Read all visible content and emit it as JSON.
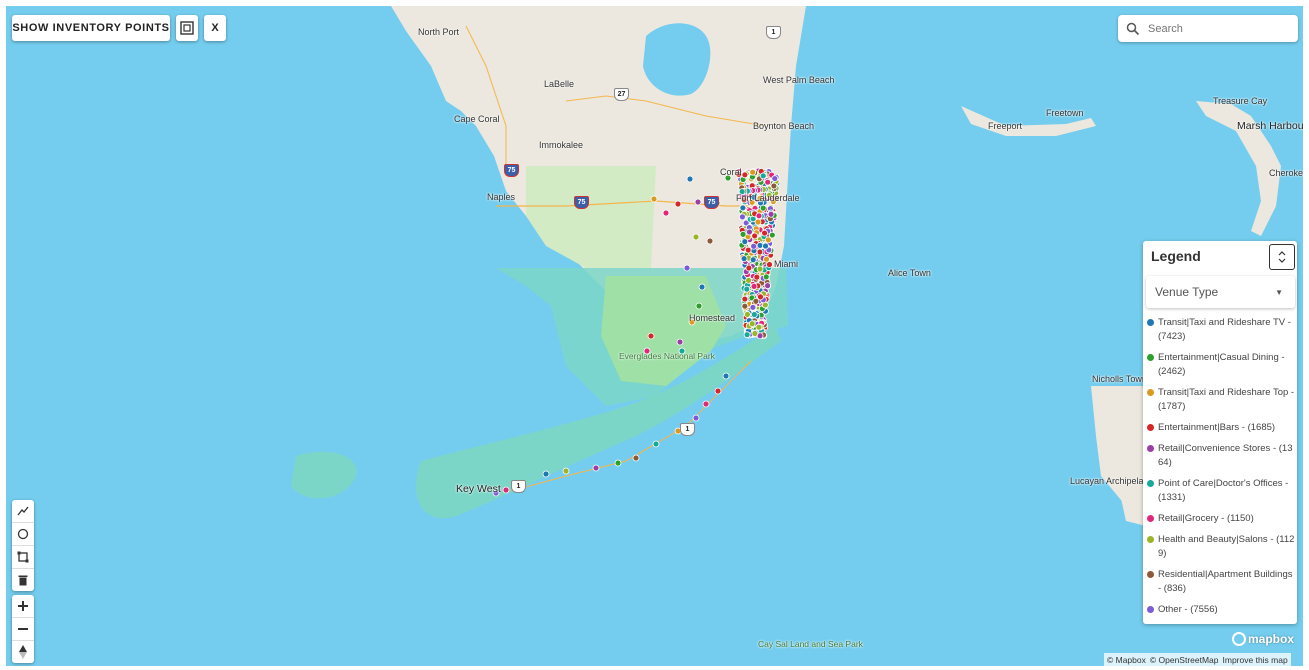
{
  "toolbar": {
    "show_inventory_label": "SHOW INVENTORY POINTS",
    "close_label": "X"
  },
  "search": {
    "placeholder": "Search"
  },
  "legend": {
    "title": "Legend",
    "dropdown_value": "Venue Type",
    "items": [
      {
        "label": "Transit|Taxi and Rideshare TV - (7423)",
        "color": "#1f77b4"
      },
      {
        "label": "Entertainment|Casual Dining - (2462)",
        "color": "#2ca02c"
      },
      {
        "label": "Transit|Taxi and Rideshare Top - (1787)",
        "color": "#d99a1e"
      },
      {
        "label": "Entertainment|Bars - (1685)",
        "color": "#d62728"
      },
      {
        "label": "Retail|Convenience Stores - (1364)",
        "color": "#9b3fa6"
      },
      {
        "label": "Point of Care|Doctor's Offices - (1331)",
        "color": "#17a89a"
      },
      {
        "label": "Retail|Grocery - (1150)",
        "color": "#e0287a"
      },
      {
        "label": "Health and Beauty|Salons - (1129)",
        "color": "#9ab52a"
      },
      {
        "label": "Residential|Apartment Buildings - (836)",
        "color": "#8c5a3a"
      },
      {
        "label": "Other - (7556)",
        "color": "#7b5cd6"
      }
    ]
  },
  "map": {
    "places": [
      {
        "name": "North Port",
        "cls": "place"
      },
      {
        "name": "LaBelle",
        "cls": "place"
      },
      {
        "name": "Cape Coral",
        "cls": "place"
      },
      {
        "name": "Immokalee",
        "cls": "place"
      },
      {
        "name": "Naples",
        "cls": "place"
      },
      {
        "name": "West Palm Beach",
        "cls": "place"
      },
      {
        "name": "Boynton Beach",
        "cls": "place"
      },
      {
        "name": "Coral",
        "cls": "place"
      },
      {
        "name": "Fort Lauderdale",
        "cls": "place"
      },
      {
        "name": "Miami",
        "cls": "place"
      },
      {
        "name": "Homestead",
        "cls": "place"
      },
      {
        "name": "Everglades National Park",
        "cls": "place park"
      },
      {
        "name": "Key West",
        "cls": "place big"
      },
      {
        "name": "Alice Town",
        "cls": "place"
      },
      {
        "name": "Freeport",
        "cls": "place"
      },
      {
        "name": "Freetown",
        "cls": "place"
      },
      {
        "name": "Treasure Cay",
        "cls": "place"
      },
      {
        "name": "Marsh Harbour",
        "cls": "place big"
      },
      {
        "name": "Cherokee",
        "cls": "place"
      },
      {
        "name": "Nicholls Town",
        "cls": "place"
      },
      {
        "name": "Lucayan Archipelago",
        "cls": "place"
      },
      {
        "name": "Cay Sal Land and Sea Park",
        "cls": "place park"
      }
    ],
    "shields": [
      {
        "text": "1",
        "cls": "shield"
      },
      {
        "text": "27",
        "cls": "shield"
      },
      {
        "text": "75",
        "cls": "shield i"
      },
      {
        "text": "75",
        "cls": "shield i"
      },
      {
        "text": "75",
        "cls": "shield i"
      },
      {
        "text": "1",
        "cls": "shield"
      },
      {
        "text": "1",
        "cls": "shield"
      }
    ]
  },
  "attribution": {
    "mapbox": "© Mapbox",
    "osm": "© OpenStreetMap",
    "improve": "Improve this map",
    "logo": "mapbox"
  }
}
